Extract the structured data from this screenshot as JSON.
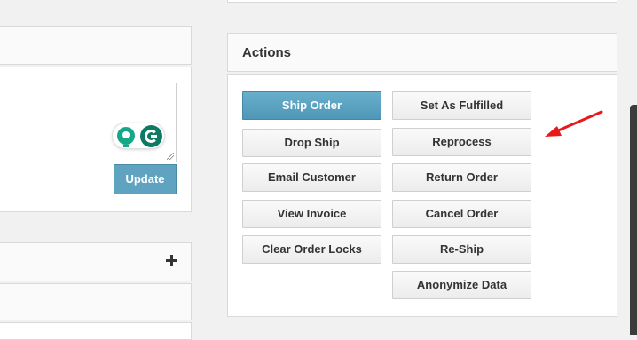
{
  "left": {
    "update_label": "Update",
    "expand_icon": "plus-icon"
  },
  "actions": {
    "title": "Actions",
    "left_column": [
      "Ship Order",
      "Drop Ship",
      "Email Customer",
      "View Invoice",
      "Clear Order Locks"
    ],
    "right_column": [
      "Set As Fulfilled",
      "Reprocess",
      "Return Order",
      "Cancel Order",
      "Re-Ship",
      "Anonymize Data"
    ],
    "primary_color": "#5fa3c0"
  },
  "annotation": {
    "arrow_color": "#e8191b"
  }
}
